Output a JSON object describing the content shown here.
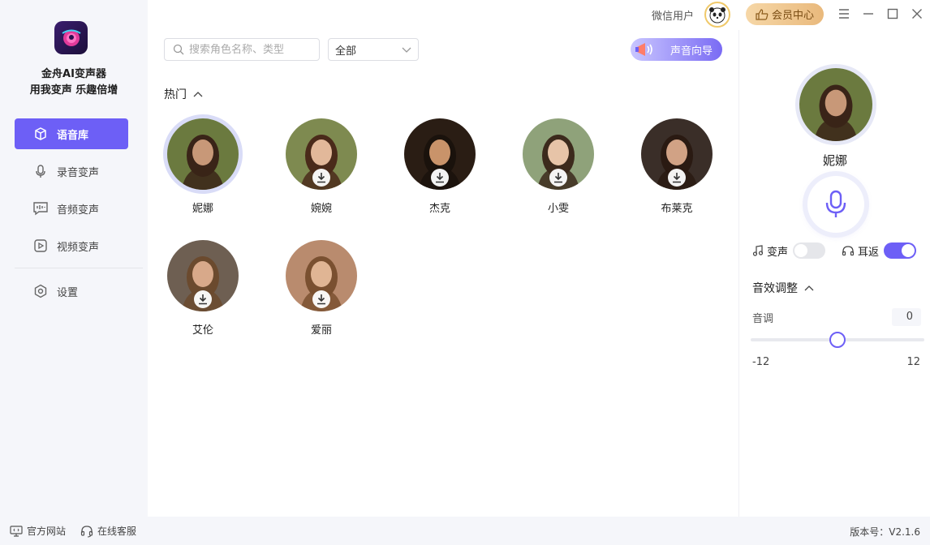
{
  "app": {
    "name": "金舟AI变声器",
    "slogan": "用我变声 乐趣倍增",
    "brand_color": "#6d5ff6"
  },
  "sidebar": {
    "items": [
      {
        "label": "语音库",
        "icon": "cube-icon",
        "active": true
      },
      {
        "label": "录音变声",
        "icon": "mic-icon",
        "active": false
      },
      {
        "label": "音频变声",
        "icon": "audio-wave-icon",
        "active": false
      },
      {
        "label": "视频变声",
        "icon": "play-icon",
        "active": false
      }
    ],
    "settings_label": "设置"
  },
  "topbar": {
    "user_label": "微信用户",
    "vip_label": "会员中心"
  },
  "toolbar": {
    "search_placeholder": "搜索角色名称、类型",
    "filter_selected": "全部",
    "guide_label": "声音向导"
  },
  "section": {
    "title": "热门"
  },
  "voices": [
    {
      "name": "妮娜",
      "selected": true,
      "downloaded": true,
      "bg": "#6b7a3f",
      "skin": "#c89878",
      "hair": "#3a2418"
    },
    {
      "name": "婉婉",
      "selected": false,
      "downloaded": false,
      "bg": "#7e8a50",
      "skin": "#e2b89a",
      "hair": "#4a2a1a"
    },
    {
      "name": "杰克",
      "selected": false,
      "downloaded": false,
      "bg": "#2a1d14",
      "skin": "#c9936a",
      "hair": "#1a120c"
    },
    {
      "name": "小雯",
      "selected": false,
      "downloaded": false,
      "bg": "#8fa27a",
      "skin": "#e7c4a8",
      "hair": "#3c2a1c"
    },
    {
      "name": "布莱克",
      "selected": false,
      "downloaded": false,
      "bg": "#3a2e28",
      "skin": "#d1a285",
      "hair": "#2a1a12"
    },
    {
      "name": "艾伦",
      "selected": false,
      "downloaded": false,
      "bg": "#6e5f52",
      "skin": "#d8a98a",
      "hair": "#6b4a2e"
    },
    {
      "name": "爱丽",
      "selected": false,
      "downloaded": false,
      "bg": "#b98b6e",
      "skin": "#e0b594",
      "hair": "#7a5030"
    }
  ],
  "right_panel": {
    "current_voice": "妮娜",
    "voice_change_label": "变声",
    "voice_change_on": false,
    "monitor_label": "耳返",
    "monitor_on": true,
    "fx_title": "音效调整",
    "pitch_label": "音调",
    "pitch_value": "0",
    "pitch_min": "-12",
    "pitch_max": "12",
    "pitch_fraction": 0.5
  },
  "footer": {
    "website_label": "官方网站",
    "support_label": "在线客服",
    "version": "版本号：V2.1.6"
  }
}
